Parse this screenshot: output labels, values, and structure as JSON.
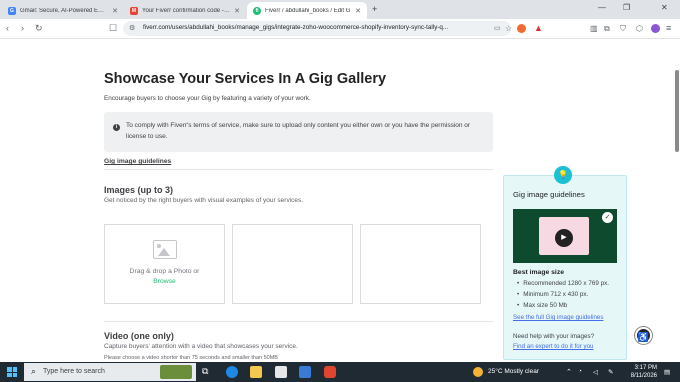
{
  "browser": {
    "tabs": [
      {
        "title": "Gmail: Secure, AI-Powered Email fo",
        "favicon": "G",
        "favicon_color": "#4285f4"
      },
      {
        "title": "Your Fiverr confirmation code - abd",
        "favicon": "M",
        "favicon_color": "#ea4335"
      },
      {
        "title": "Fiverr / abdullahi_books / Edit G",
        "favicon": "fi",
        "favicon_color": "#1dbf73"
      }
    ],
    "url": "fiverr.com/users/abdullahi_books/manage_gigs/integrate-zoho-woocommerce-shopify-inventory-sync-tally-q..."
  },
  "page": {
    "title": "Showcase Your Services In A Gig Gallery",
    "subtitle": "Encourage buyers to choose your Gig by featuring a variety of your work.",
    "notice": "To comply with Fiverr's terms of service, make sure to upload only content you either own or you have the permission or license to use.",
    "guidelines_link": "Gig image guidelines",
    "images": {
      "heading": "Images (up to 3)",
      "description": "Get noticed by the right buyers with visual examples of your services.",
      "drag_text": "Drag & drop a Photo or",
      "browse": "Browse"
    },
    "video": {
      "heading": "Video (one only)",
      "description": "Capture buyers' attention with a video that showcases your service.",
      "note": "Please choose a video shorter than 75 seconds and smaller than 50MB"
    }
  },
  "tooltip": {
    "title": "Gig image guidelines",
    "best_size_heading": "Best image size",
    "items": [
      "Recommended 1280 x 769 px.",
      "Minimum 712 x 430 px.",
      "Max size 50 Mb"
    ],
    "see_full_link": "See the full Gig image guidelines",
    "help_text": "Need help with your images?",
    "expert_link": "Find an expert to do it for you"
  },
  "taskbar": {
    "search_placeholder": "Type here to search",
    "weather": "25°C  Mostly clear",
    "time": "3:17 PM",
    "date": "8/11/2026"
  },
  "colors": {
    "accent": "#1dbf73",
    "link": "#446ee7",
    "tooltip_bg": "#e6f7f8"
  }
}
